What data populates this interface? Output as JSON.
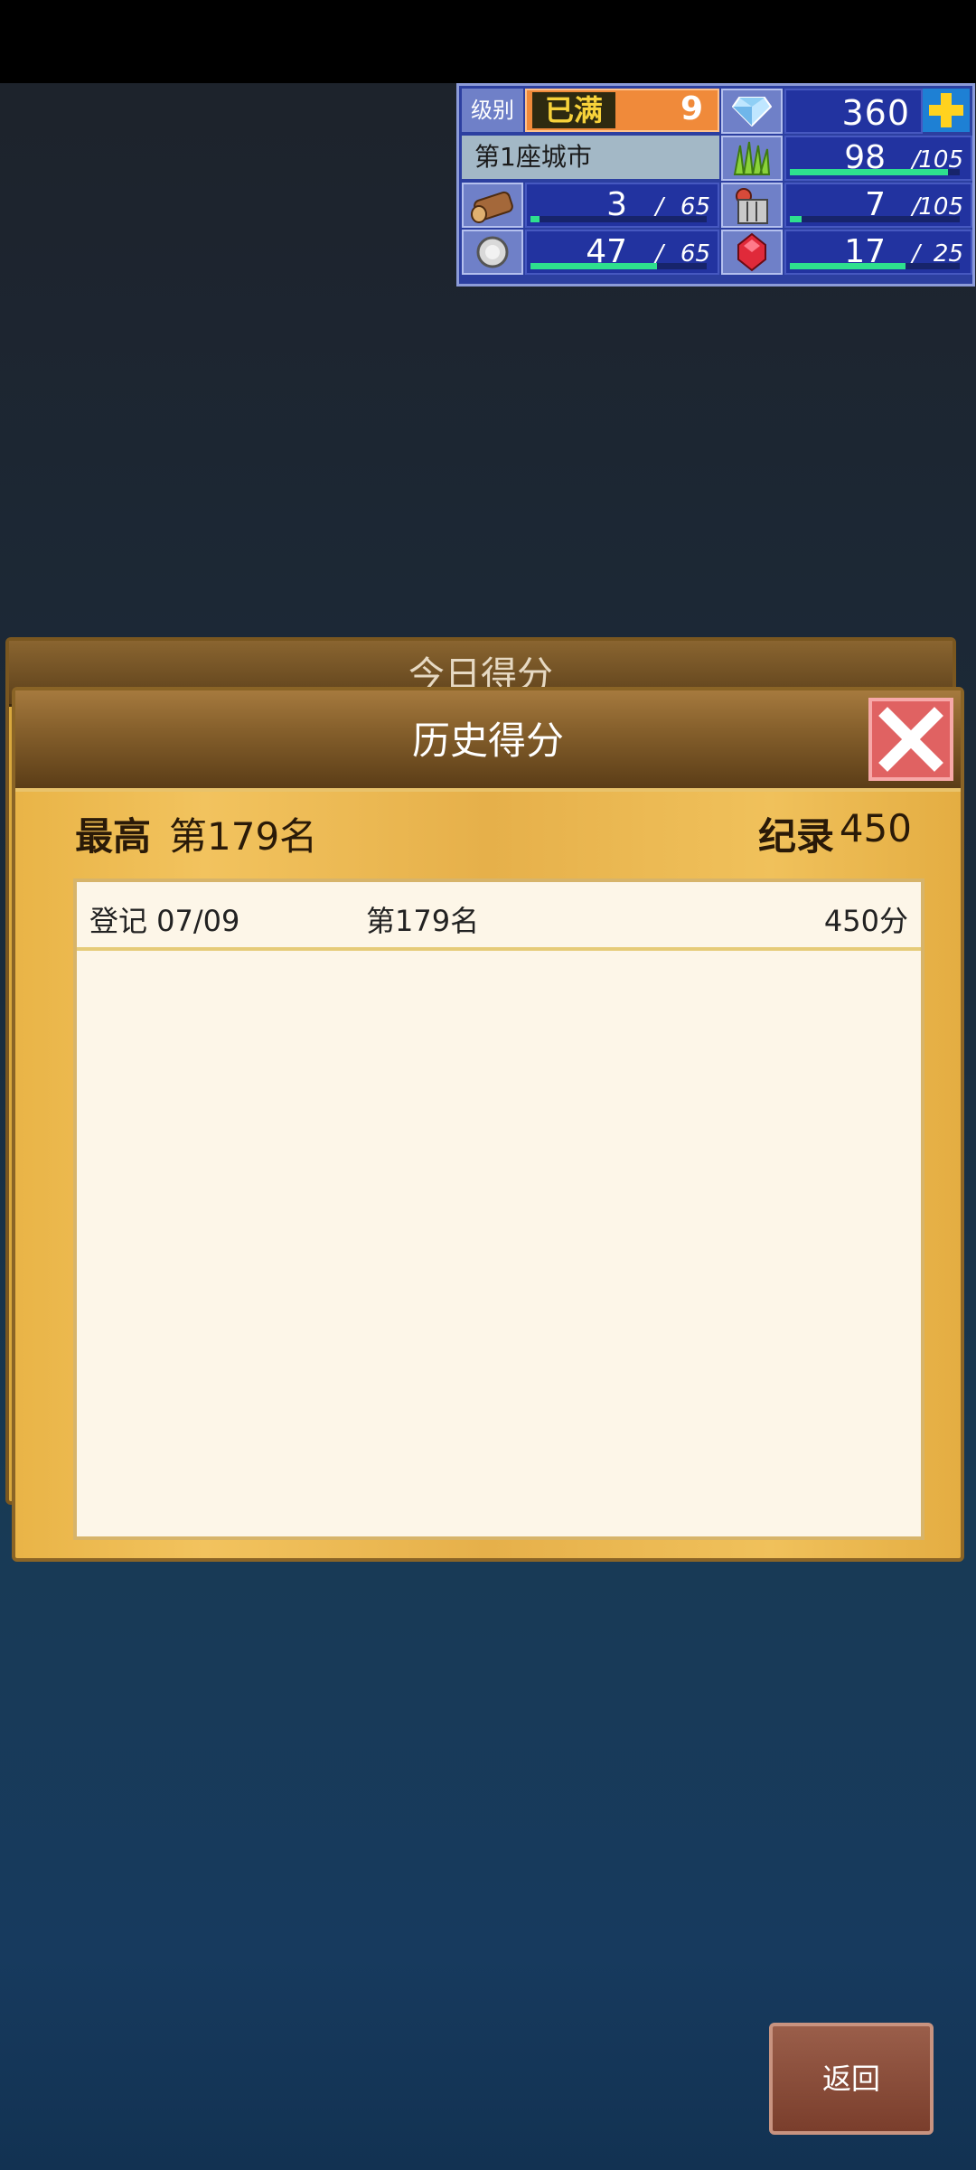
{
  "hud": {
    "level_label": "级别",
    "level_badge": "已满",
    "level_value": "9",
    "gems": "360",
    "city_name": "第1座城市",
    "resources": [
      {
        "icon": "grass-icon",
        "value": "98",
        "max": "105",
        "fill": 0.93,
        "color": "#2ee08e"
      },
      {
        "icon": "wood-log-icon",
        "value": "3",
        "max": "65",
        "fill": 0.05,
        "color": "#2ee08e"
      },
      {
        "icon": "food-basket-icon",
        "value": "7",
        "max": "105",
        "fill": 0.07,
        "color": "#2ee08e"
      },
      {
        "icon": "stone-icon",
        "value": "47",
        "max": "65",
        "fill": 0.72,
        "color": "#2ee08e"
      },
      {
        "icon": "ruby-icon",
        "value": "17",
        "max": "25",
        "fill": 0.68,
        "color": "#2ee08e"
      }
    ]
  },
  "back_panel": {
    "title": "今日得分"
  },
  "panel": {
    "title": "历史得分",
    "best_label": "最高",
    "best_value": "第179名",
    "record_label": "纪录",
    "record_value": "450",
    "rows": [
      {
        "date": "登记 07/09",
        "rank": "第179名",
        "score": "450分"
      }
    ]
  },
  "footer": {
    "return_label": "返回"
  },
  "colors": {
    "accent_gold": "#e9b447",
    "close_red": "#e06262",
    "hud_blue": "#2c3fa0"
  }
}
